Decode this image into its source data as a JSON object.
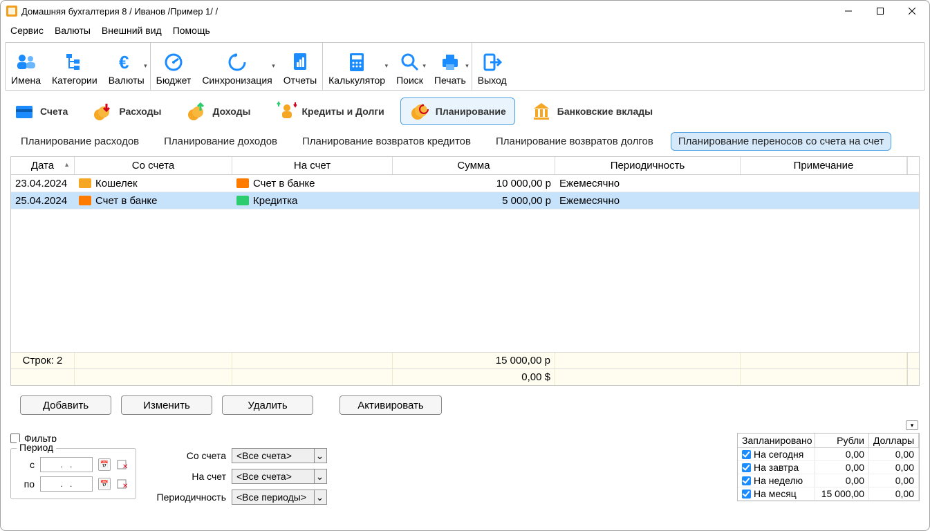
{
  "title": "Домашняя бухгалтерия 8  / Иванов /Пример 1/ /",
  "menu": {
    "service": "Сервис",
    "currencies": "Валюты",
    "appearance": "Внешний вид",
    "help": "Помощь"
  },
  "toolbar": {
    "names": "Имена",
    "categories": "Категории",
    "currencies": "Валюты",
    "budget": "Бюджет",
    "sync": "Синхронизация",
    "reports": "Отчеты",
    "calc": "Калькулятор",
    "search": "Поиск",
    "print": "Печать",
    "exit": "Выход"
  },
  "sections": {
    "accounts": "Счета",
    "expenses": "Расходы",
    "income": "Доходы",
    "credits": "Кредиты и Долги",
    "planning": "Планирование",
    "deposits": "Банковские вклады"
  },
  "subtabs": {
    "exp": "Планирование расходов",
    "inc": "Планирование доходов",
    "cred": "Планирование возвратов кредитов",
    "debt": "Планирование возвратов долгов",
    "transfer": "Планирование переносов со счета на счет"
  },
  "grid": {
    "headers": {
      "date": "Дата",
      "from": "Со счета",
      "to": "На счет",
      "sum": "Сумма",
      "period": "Периодичность",
      "note": "Примечание"
    },
    "rows": [
      {
        "date": "23.04.2024",
        "from": "Кошелек",
        "to": "Счет в банке",
        "sum": "10 000,00 р",
        "period": "Ежемесячно",
        "fromIcon": "wallet",
        "toIcon": "bank2"
      },
      {
        "date": "25.04.2024",
        "from": "Счет в банке",
        "to": "Кредитка",
        "sum": "5 000,00 р",
        "period": "Ежемесячно",
        "fromIcon": "bank2",
        "toIcon": "credit"
      }
    ],
    "footer": {
      "rows": "Строк: 2",
      "sumR": "15 000,00 р",
      "sumD": "0,00 $"
    }
  },
  "actions": {
    "add": "Добавить",
    "edit": "Изменить",
    "del": "Удалить",
    "activate": "Активировать"
  },
  "filter": {
    "label": "Фильтр",
    "period": "Период",
    "from": "с",
    "to": "по",
    "dots": ".   .",
    "fromAcc": "Со счета",
    "toAcc": "На счет",
    "periodicity": "Периодичность",
    "allAcc": "<Все счета>",
    "allPer": "<Все периоды>"
  },
  "planned": {
    "head": {
      "c1": "Запланировано",
      "c2": "Рубли",
      "c3": "Доллары"
    },
    "rows": [
      {
        "label": "На сегодня",
        "rub": "0,00",
        "usd": "0,00"
      },
      {
        "label": "На завтра",
        "rub": "0,00",
        "usd": "0,00"
      },
      {
        "label": "На неделю",
        "rub": "0,00",
        "usd": "0,00"
      },
      {
        "label": "На месяц",
        "rub": "15 000,00",
        "usd": "0,00"
      }
    ]
  }
}
